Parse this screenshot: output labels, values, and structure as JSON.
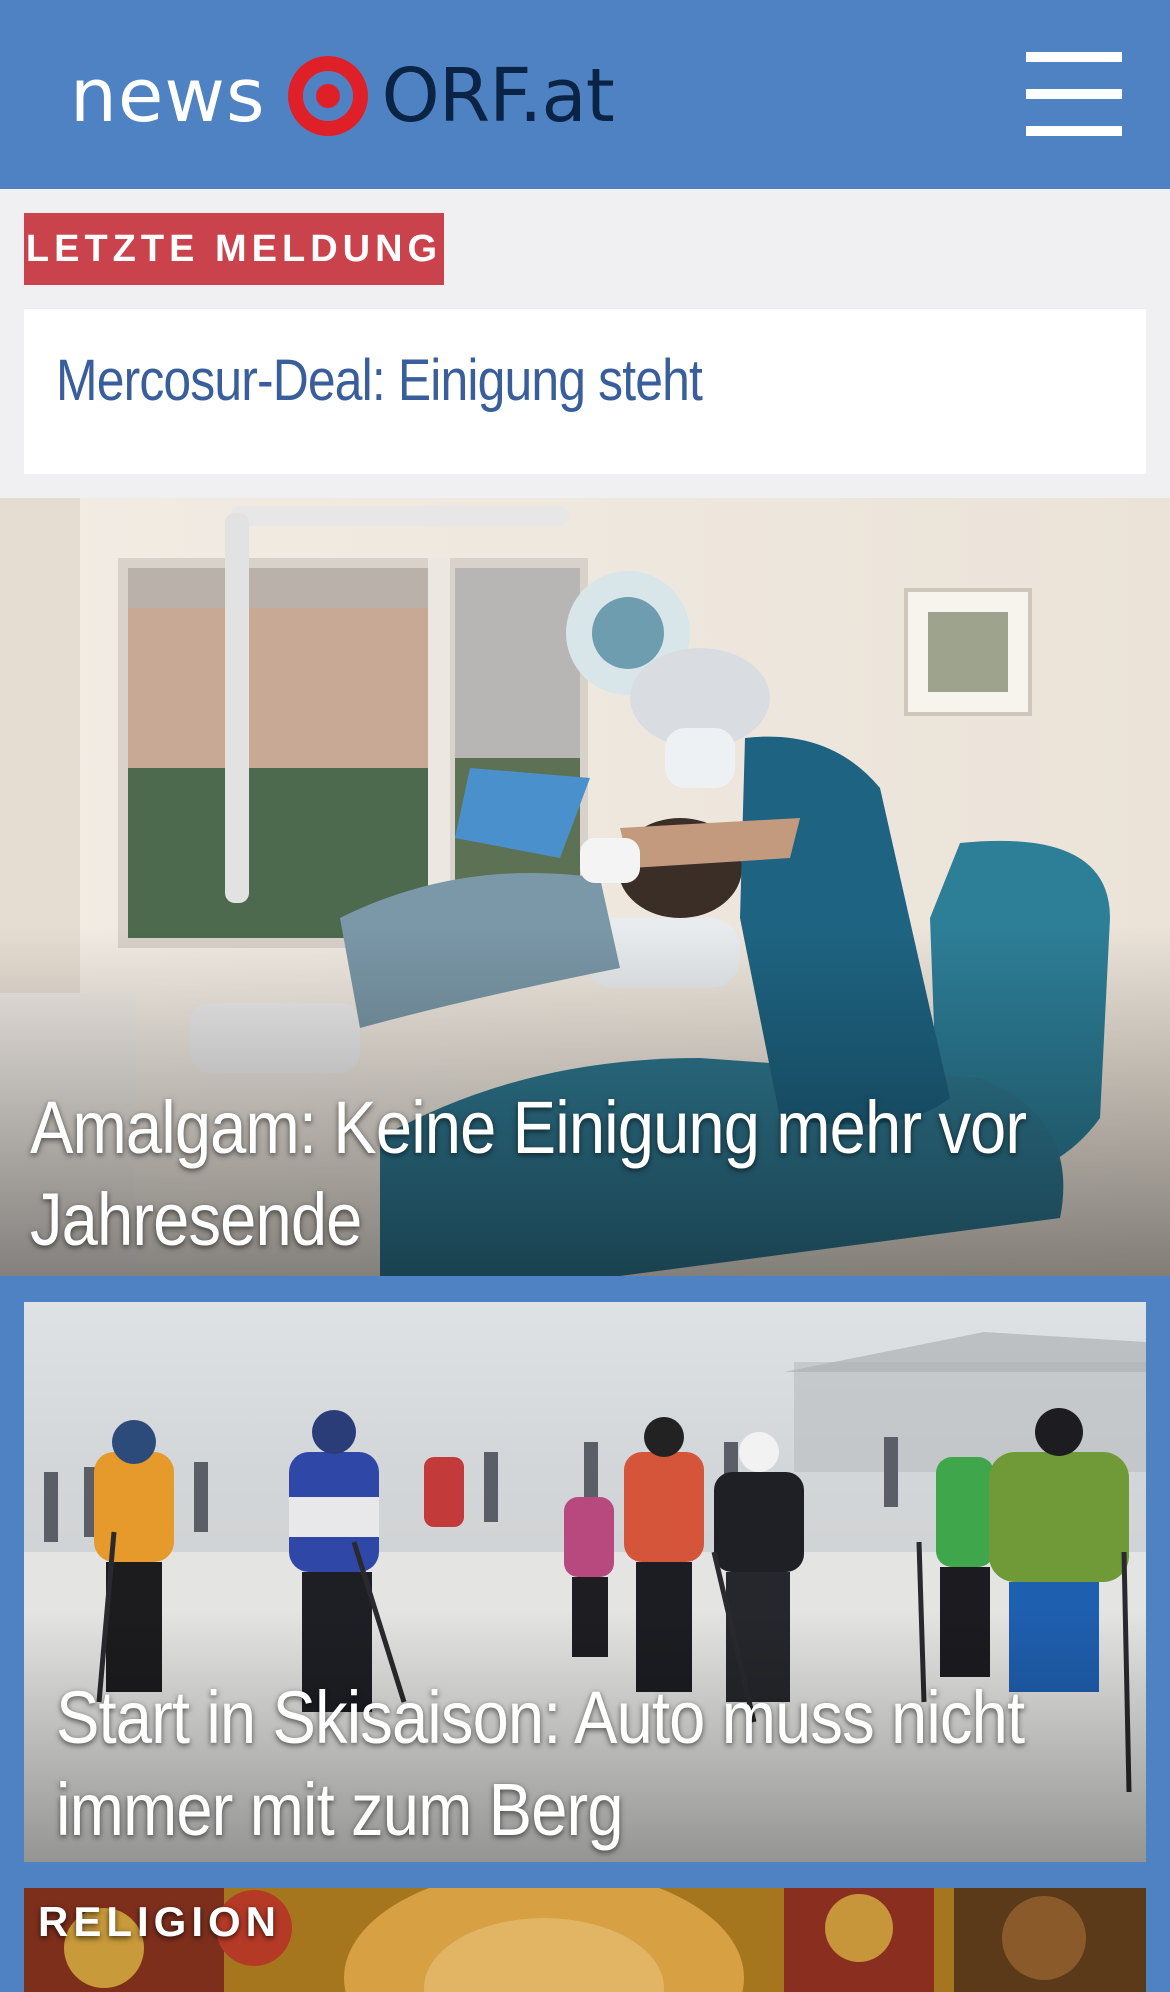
{
  "header": {
    "logo_news": "news",
    "logo_orf": "ORF.at",
    "menu_icon": "hamburger-menu-icon",
    "colors": {
      "header_bg": "#4f82c2",
      "logo_mark": "#e02028",
      "logo_orf_text": "#0b2344"
    }
  },
  "breaking": {
    "label": "LETZTE MELDUNG",
    "title": "Mercosur-Deal: Einigung steht",
    "colors": {
      "label_bg": "#c9424c",
      "title": "#3a5e9b"
    }
  },
  "stories": [
    {
      "headline": "Amalgam: Keine Einigung mehr vor Jahresende"
    },
    {
      "headline": "Start in Skisaison: Auto muss nicht immer mit zum Berg"
    },
    {
      "category": "RELIGION"
    }
  ]
}
